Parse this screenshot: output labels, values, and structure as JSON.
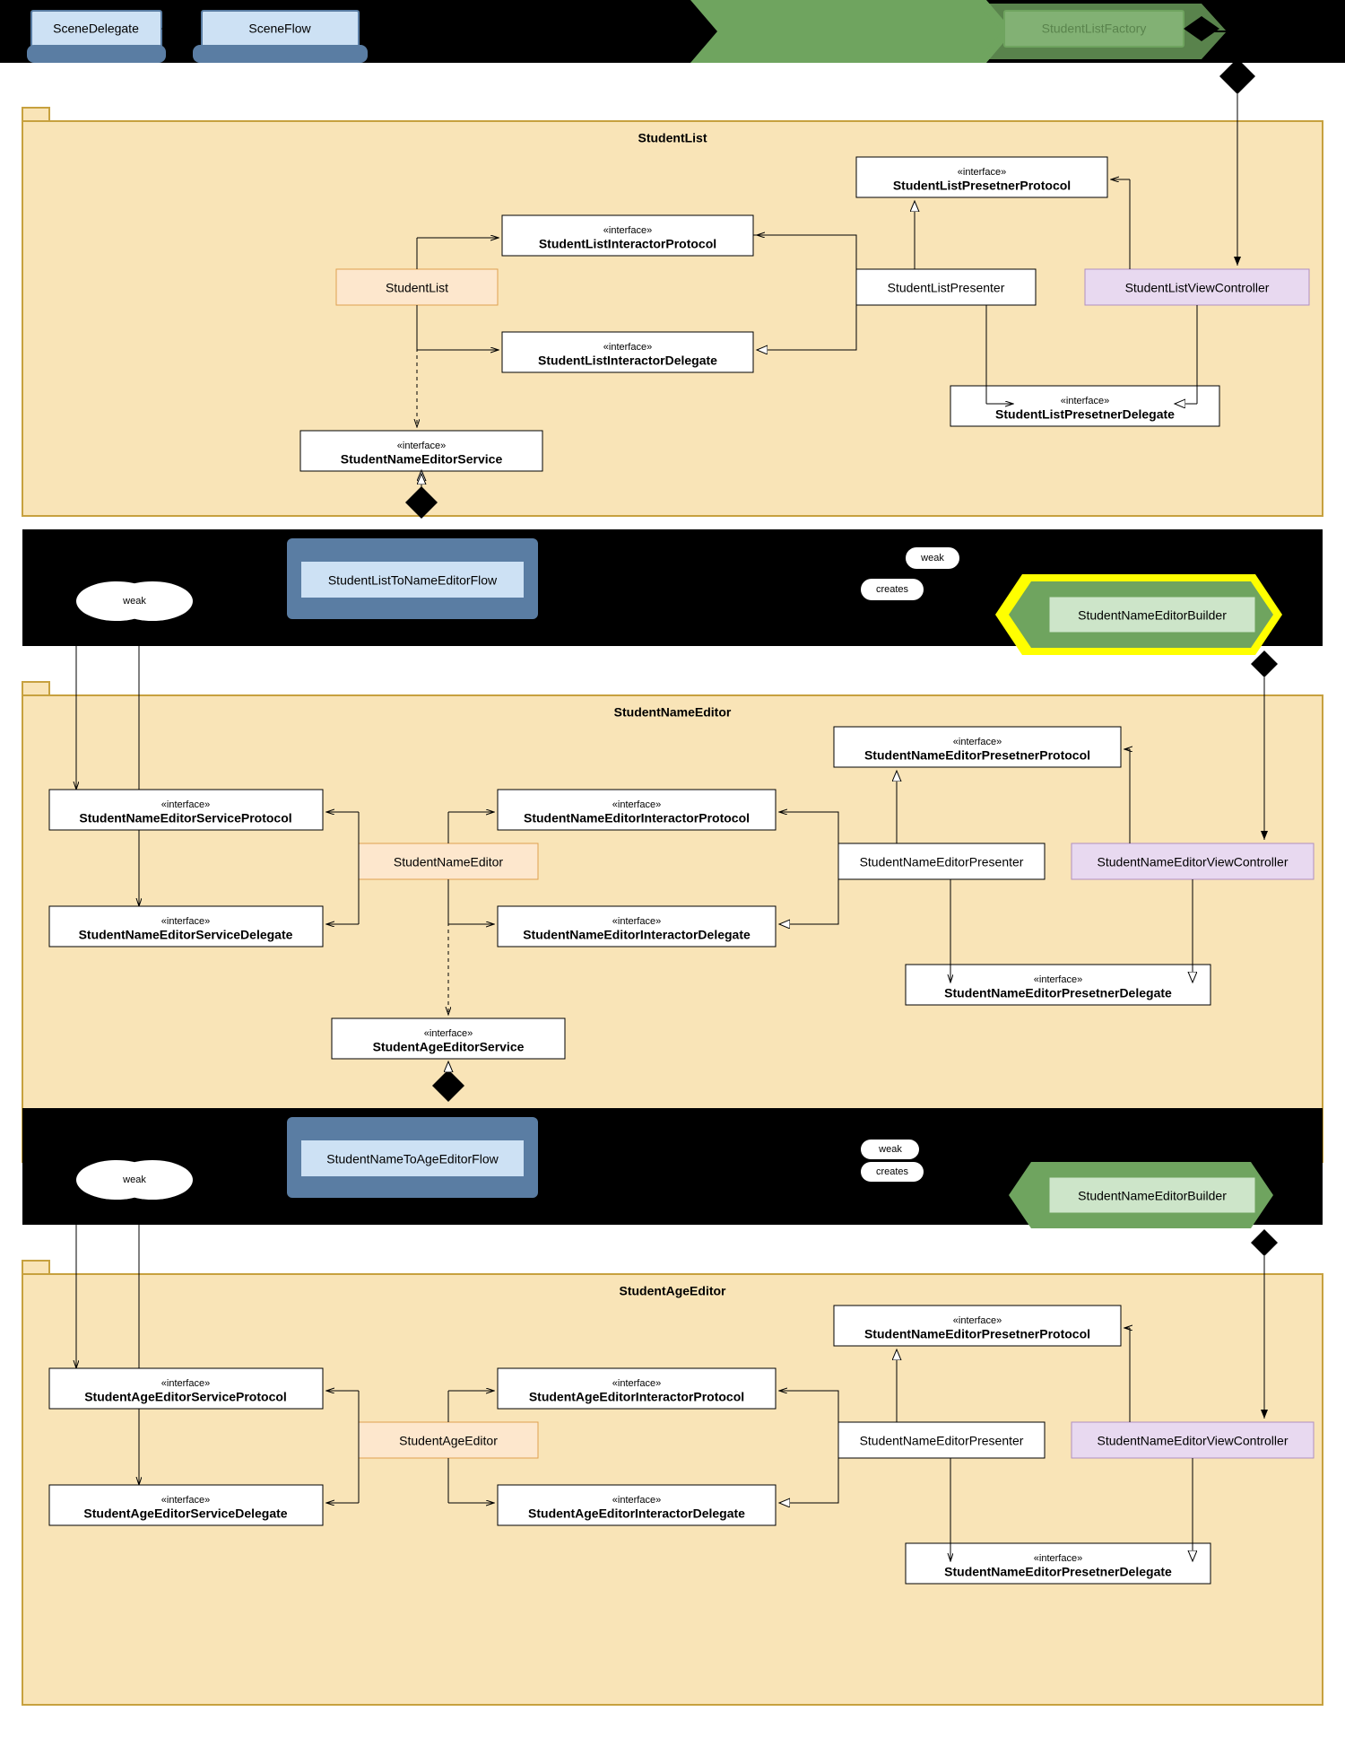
{
  "top": {
    "sceneDelegate": "SceneDelegate",
    "sceneFlow": "SceneFlow",
    "studentListFactory": "StudentListFactory"
  },
  "interface": "«interface»",
  "labels": {
    "weak": "weak",
    "creates": "creates"
  },
  "packages": {
    "studentList": {
      "title": "StudentList",
      "interactor": "StudentList",
      "interactorProtocol": "StudentListInteractorProtocol",
      "interactorDelegate": "StudentListInteractorDelegate",
      "presenter": "StudentListPresenter",
      "presenterProtocol": "StudentListPresetnerProtocol",
      "presenterDelegate": "StudentListPresetnerDelegate",
      "viewController": "StudentListViewController",
      "service": "StudentNameEditorService"
    },
    "flow1": {
      "name": "StudentListToNameEditorFlow",
      "builder": "StudentNameEditorBuilder"
    },
    "studentNameEditor": {
      "title": "StudentNameEditor",
      "interactor": "StudentNameEditor",
      "interactorProtocol": "StudentNameEditorInteractorProtocol",
      "interactorDelegate": "StudentNameEditorInteractorDelegate",
      "presenter": "StudentNameEditorPresenter",
      "presenterProtocol": "StudentNameEditorPresetnerProtocol",
      "presenterDelegate": "StudentNameEditorPresetnerDelegate",
      "viewController": "StudentNameEditorViewController",
      "serviceProtocol": "StudentNameEditorServiceProtocol",
      "serviceDelegate": "StudentNameEditorServiceDelegate",
      "service": "StudentAgeEditorService"
    },
    "flow2": {
      "name": "StudentNameToAgeEditorFlow",
      "builder": "StudentNameEditorBuilder"
    },
    "studentAgeEditor": {
      "title": "StudentAgeEditor",
      "interactor": "StudentAgeEditor",
      "interactorProtocol": "StudentAgeEditorInteractorProtocol",
      "interactorDelegate": "StudentAgeEditorInteractorDelegate",
      "presenter": "StudentNameEditorPresenter",
      "presenterProtocol": "StudentNameEditorPresetnerProtocol",
      "presenterDelegate": "StudentNameEditorPresetnerDelegate",
      "viewController": "StudentNameEditorViewController",
      "serviceProtocol": "StudentAgeEditorServiceProtocol",
      "serviceDelegate": "StudentAgeEditorServiceDelegate"
    }
  },
  "colors": {
    "blueLight": "#cde1f4",
    "blueBorder": "#5a7da3",
    "greenLight": "#cde5c9",
    "greenBorder": "#6fa45f",
    "packageBg": "#f9e4b7",
    "packageBorder": "#c7a13f",
    "orange": "#fde7cd",
    "orangeBorder": "#e0a050",
    "purple": "#e8d9f0",
    "purpleBorder": "#b090c0",
    "black": "#000",
    "yellow": "#ffff00"
  }
}
